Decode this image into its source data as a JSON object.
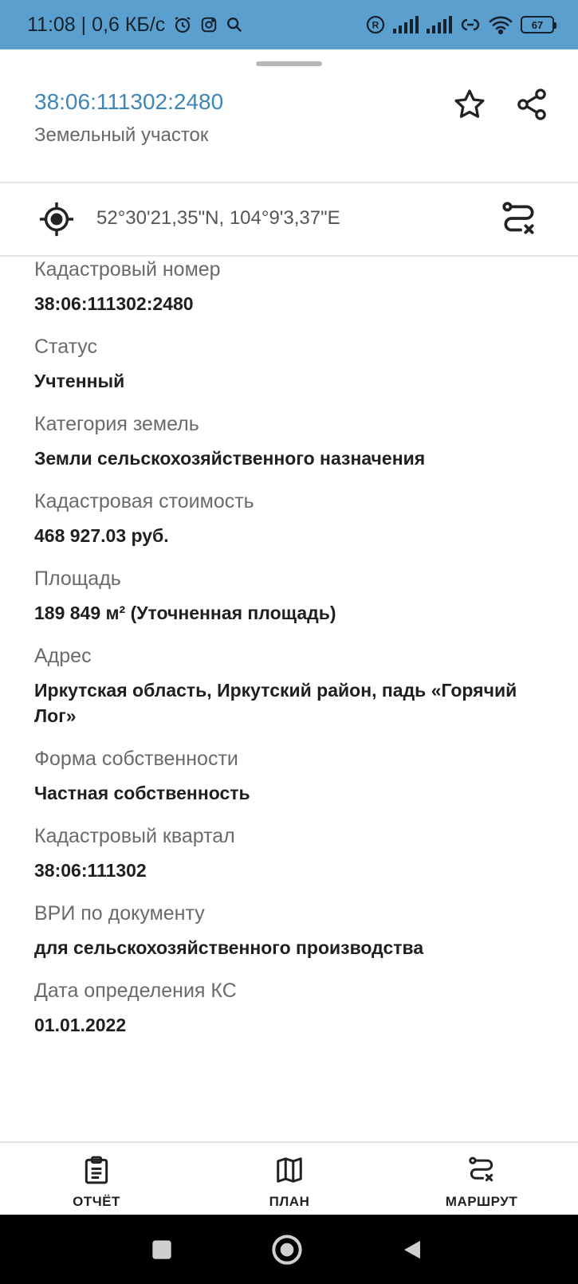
{
  "status_bar": {
    "time_speed": "11:08 | 0,6 КБ/с",
    "battery": "67"
  },
  "header": {
    "title": "38:06:111302:2480",
    "subtitle": "Земельный участок"
  },
  "coordinates": "52°30'21,35\"N, 104°9'3,37\"E",
  "fields": [
    {
      "label": "Кадастровый номер",
      "value": "38:06:111302:2480"
    },
    {
      "label": "Статус",
      "value": "Учтенный"
    },
    {
      "label": "Категория земель",
      "value": "Земли сельскохозяйственного назначения"
    },
    {
      "label": "Кадастровая стоимость",
      "value": "468 927.03 руб."
    },
    {
      "label": "Площадь",
      "value": "189 849 м² (Уточненная площадь)"
    },
    {
      "label": "Адрес",
      "value": "Иркутская область, Иркутский район, падь «Горячий Лог»"
    },
    {
      "label": "Форма собственности",
      "value": "Частная собственность"
    },
    {
      "label": "Кадастровый квартал",
      "value": "38:06:111302"
    },
    {
      "label": "ВРИ по документу",
      "value": "для сельскохозяйственного производства"
    },
    {
      "label": "Дата определения КС",
      "value": "01.01.2022"
    }
  ],
  "actions": {
    "report": "ОТЧЁТ",
    "plan": "ПЛАН",
    "route": "МАРШРУТ"
  }
}
